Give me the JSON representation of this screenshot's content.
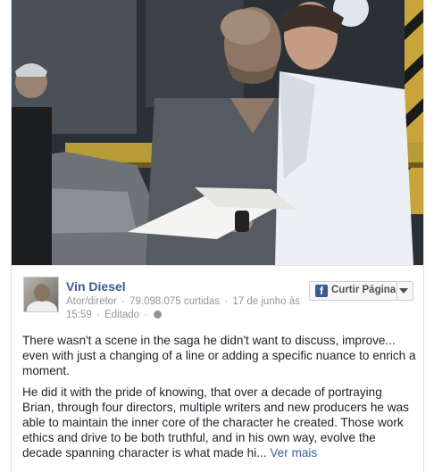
{
  "post": {
    "page_name": "Vin Diesel",
    "category": "Ator/diretor",
    "likes": "79.098.075 curtidas",
    "date": "17 de junho às 15:59",
    "edited": "Editado",
    "privacy_icon": "globe-icon",
    "paragraphs": [
      "There wasn't a scene in the saga he didn't want to discuss, improve... even with just a changing of a line or adding a specific nuance to enrich a moment.",
      "He did it with the pride of knowing, that over a decade of portraying Brian, through four directors, multiple writers and new producers he was able to maintain the inner core of the character he created. Those work ethics and drive to be both truthful, and in his own way, evolve the decade spanning character is what made hi..."
    ],
    "see_more": "Ver mais"
  },
  "like_button": {
    "label": "Curtir Página",
    "icon": "facebook-icon",
    "menu_icon": "chevron-down-icon"
  },
  "colors": {
    "brand": "#3b5998",
    "text": "#1d2129",
    "meta": "#90949c"
  }
}
